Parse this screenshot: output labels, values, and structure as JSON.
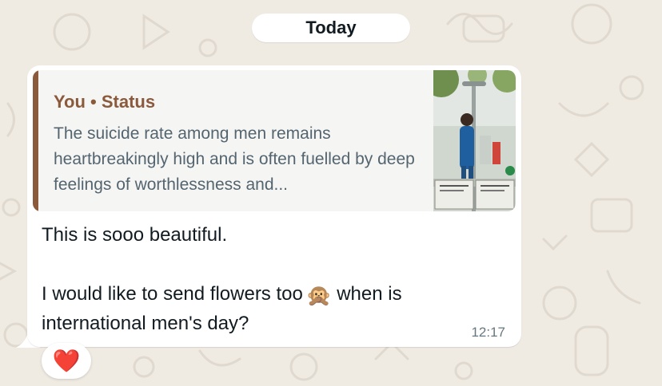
{
  "chat": {
    "date_separator": "Today",
    "message": {
      "reply": {
        "author": "You • Status",
        "text": "The suicide rate among men remains heartbreakingly high and is often fuelled by deep feelings of worthlessness and...",
        "thumbnail_icon": "status-photo-thumbnail"
      },
      "text_line1": "This is sooo beautiful.",
      "text_line2_part1": "I would like to send flowers too",
      "emoji": "🙊",
      "text_line2_part2": "when is international men's day?",
      "time": "12:17",
      "reaction": "❤️"
    }
  },
  "colors": {
    "wallpaper": "#efeae2",
    "bubble": "#ffffff",
    "quote_accent": "#8b5a3c",
    "timestamp": "#667781"
  }
}
